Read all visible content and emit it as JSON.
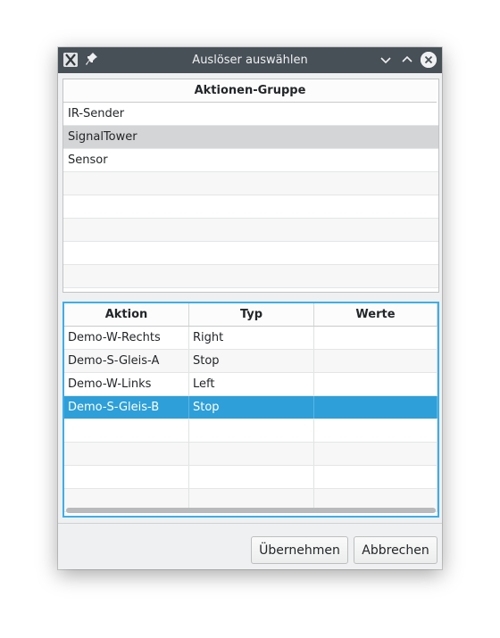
{
  "window": {
    "title": "Auslöser auswählen"
  },
  "group_table": {
    "header": "Aktionen-Gruppe",
    "rows": [
      {
        "label": "IR-Sender",
        "selected": false
      },
      {
        "label": "SignalTower",
        "selected": true
      },
      {
        "label": "Sensor",
        "selected": false
      }
    ]
  },
  "action_table": {
    "headers": [
      "Aktion",
      "Typ",
      "Werte"
    ],
    "rows": [
      {
        "aktion": "Demo-W-Rechts",
        "typ": "Right",
        "werte": ""
      },
      {
        "aktion": "Demo-S-Gleis-A",
        "typ": "Stop",
        "werte": ""
      },
      {
        "aktion": "Demo-W-Links",
        "typ": "Left",
        "werte": ""
      },
      {
        "aktion": "Demo-S-Gleis-B",
        "typ": "Stop",
        "werte": "",
        "selected": true
      }
    ]
  },
  "buttons": {
    "apply": "Übernehmen",
    "cancel": "Abbrechen"
  },
  "icons": {
    "app": "app-x-icon",
    "pin": "pin-icon",
    "minimize": "chevron-down-icon",
    "maximize": "chevron-up-icon",
    "close": "close-icon"
  },
  "colors": {
    "accent": "#3daee9",
    "selection": "#2e9fd8",
    "titlebar": "#475057"
  }
}
